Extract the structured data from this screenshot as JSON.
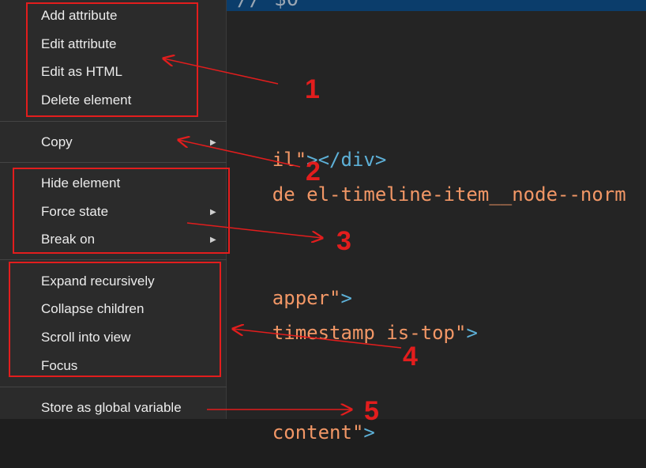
{
  "editor": {
    "top_fragment": "// $0",
    "lines": [
      [
        {
          "t": "il\"",
          "c": "tok-str"
        },
        {
          "t": "></div>",
          "c": "tok-tag"
        }
      ],
      [
        {
          "t": "de el-timeline-item__node--norm",
          "c": "tok-str"
        }
      ],
      [
        {
          "t": "apper\"",
          "c": "tok-str"
        },
        {
          "t": ">",
          "c": "tok-tag"
        }
      ],
      [
        {
          "t": "timestamp is-top\"",
          "c": "tok-str"
        },
        {
          "t": ">",
          "c": "tok-tag"
        }
      ],
      [
        {
          "t": "content\"",
          "c": "tok-str"
        },
        {
          "t": ">",
          "c": "tok-tag"
        }
      ]
    ]
  },
  "menu": {
    "items": [
      {
        "label": "Add attribute",
        "submenu": false
      },
      {
        "label": "Edit attribute",
        "submenu": false
      },
      {
        "label": "Edit as HTML",
        "submenu": false
      },
      {
        "label": "Delete element",
        "submenu": false
      },
      {
        "label": "Copy",
        "submenu": true
      },
      {
        "label": "Hide element",
        "submenu": false
      },
      {
        "label": "Force state",
        "submenu": true
      },
      {
        "label": "Break on",
        "submenu": true
      },
      {
        "label": "Expand recursively",
        "submenu": false
      },
      {
        "label": "Collapse children",
        "submenu": false
      },
      {
        "label": "Scroll into view",
        "submenu": false
      },
      {
        "label": "Focus",
        "submenu": false
      },
      {
        "label": "Store as global variable",
        "submenu": false
      }
    ],
    "submenu_glyph": "▶"
  },
  "annotations": {
    "labels": [
      "1",
      "2",
      "3",
      "4",
      "5"
    ],
    "color": "#e21d1d"
  }
}
